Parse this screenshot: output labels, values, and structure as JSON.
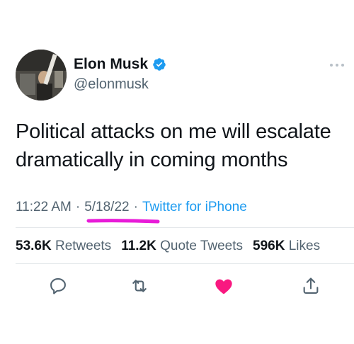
{
  "author": {
    "display_name": "Elon Musk",
    "handle": "@elonmusk",
    "verified": true
  },
  "tweet": {
    "text": "Political attacks on me will escalate dramatically in coming months",
    "time": "11:22 AM",
    "date": "5/18/22",
    "separator": "·",
    "source": "Twitter for iPhone"
  },
  "stats": {
    "retweets_count": "53.6K",
    "retweets_label": "Retweets",
    "quotes_count": "11.2K",
    "quotes_label": "Quote Tweets",
    "likes_count": "596K",
    "likes_label": "Likes"
  },
  "actions": {
    "reply_icon": "reply-icon",
    "retweet_icon": "retweet-icon",
    "like_icon": "heart-icon",
    "share_icon": "share-icon"
  },
  "colors": {
    "link_blue": "#1d9bf0",
    "secondary_gray": "#536471",
    "like_red": "#f91880",
    "annotation_magenta": "#e81bd8"
  }
}
